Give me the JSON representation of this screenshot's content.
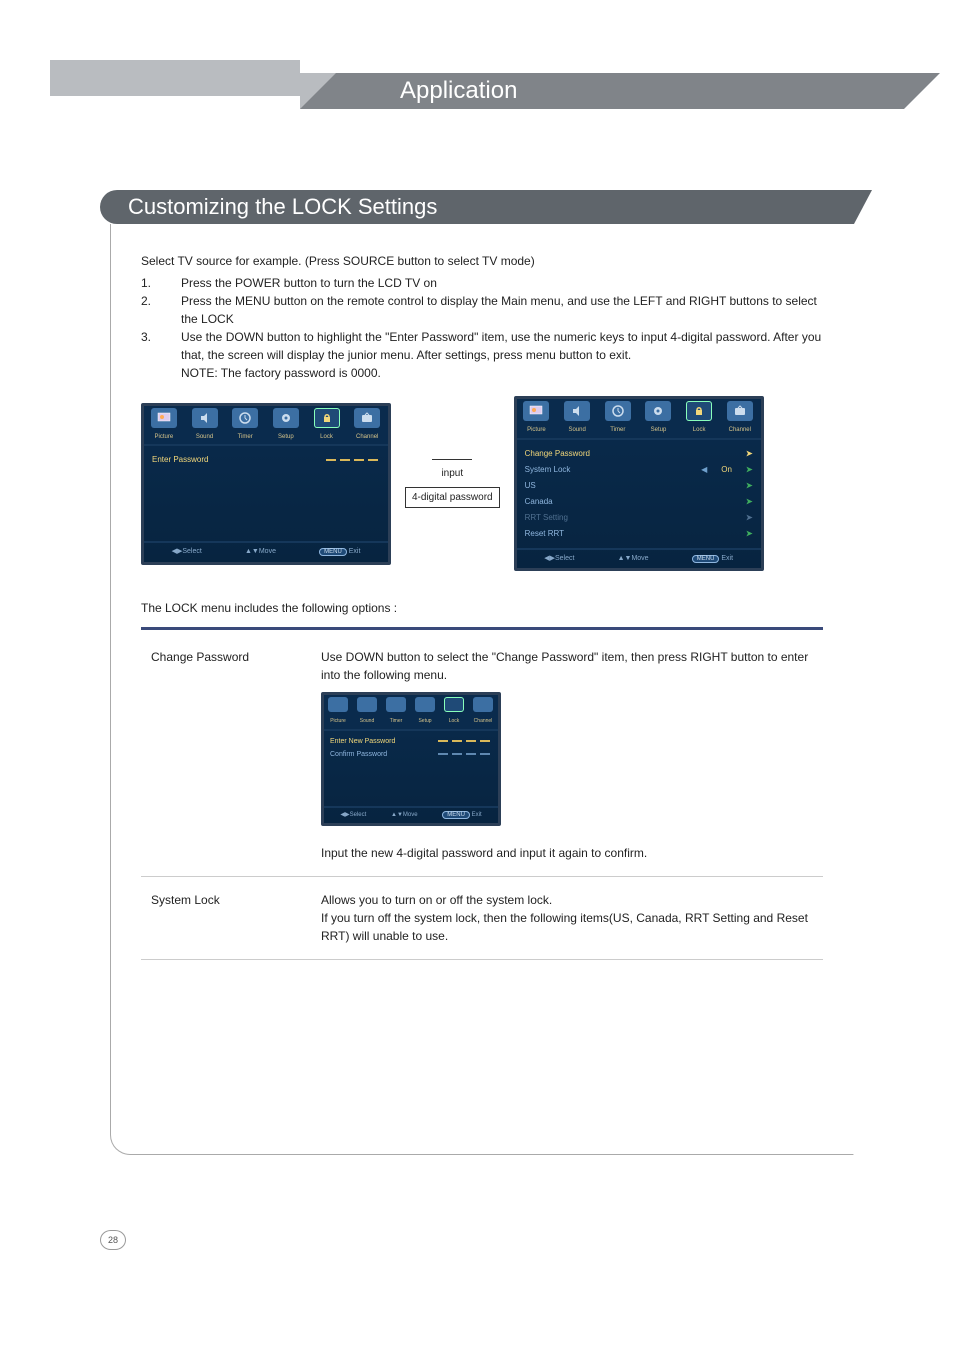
{
  "banner": {
    "title": "Application"
  },
  "section": {
    "title": "Customizing the LOCK Settings"
  },
  "intro": {
    "lead": "Select TV source for example. (Press SOURCE button to select TV mode)",
    "steps": [
      {
        "num": "1.",
        "text": "Press the POWER button to turn the LCD TV on"
      },
      {
        "num": "2.",
        "text": "Press the MENU button on the remote control to display the Main menu, and use the LEFT and RIGHT buttons to select the LOCK"
      },
      {
        "num": "3.",
        "text": "Use the DOWN button to highlight the \"Enter Password\" item, use the numeric keys to input 4-digital password. After you that, the screen will display the junior menu. After settings, press menu button to exit."
      },
      {
        "num": "",
        "text": "NOTE: The factory password is 0000."
      }
    ]
  },
  "midlabel": {
    "line1": "input",
    "line2": "4-digital password"
  },
  "tabs": [
    "Picture",
    "Sound",
    "Timer",
    "Setup",
    "Lock",
    "Channel"
  ],
  "osd1": {
    "rows": [
      {
        "label": "Enter Password",
        "type": "dash",
        "sel": true
      }
    ],
    "foot": {
      "select": "Select",
      "move": "Move",
      "btn": "MENU",
      "exit": "Exit"
    }
  },
  "osd2": {
    "rows": [
      {
        "label": "Change Password",
        "type": "chev",
        "sel": true
      },
      {
        "label": "System Lock",
        "type": "lr",
        "value": "On"
      },
      {
        "label": "US",
        "type": "chev"
      },
      {
        "label": "Canada",
        "type": "chev"
      },
      {
        "label": "RRT Setting",
        "type": "chev",
        "dim": true
      },
      {
        "label": "Reset RRT",
        "type": "chev"
      }
    ],
    "foot": {
      "select": "Select",
      "move": "Move",
      "btn": "MENU",
      "exit": "Exit"
    }
  },
  "osd3": {
    "rows": [
      {
        "label": "Enter New Password",
        "type": "dash",
        "sel": true
      },
      {
        "label": "Confirm Password",
        "type": "dash"
      }
    ],
    "foot": {
      "select": "Select",
      "move": "Move",
      "btn": "MENU",
      "exit": "Exit"
    }
  },
  "optionsIntro": "The LOCK menu includes the following options :",
  "options": {
    "changePassword": {
      "label": "Change Password",
      "desc1": "Use DOWN button to select the \"Change Password\" item, then press RIGHT button to enter into the following menu.",
      "desc2": "Input the new 4-digital password and input it again to confirm."
    },
    "systemLock": {
      "label": "System Lock",
      "desc": "Allows you to turn on or off the system lock.\nIf you turn off the system lock, then the following items(US, Canada, RRT Setting and Reset RRT) will unable to use."
    }
  },
  "pageNumber": "28"
}
